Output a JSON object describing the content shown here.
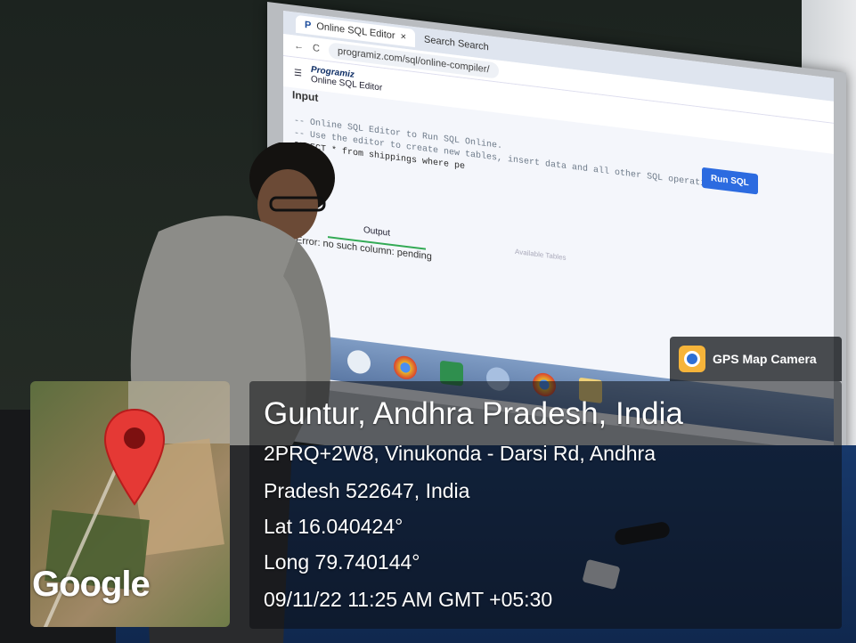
{
  "screen": {
    "tab_title": "Online SQL Editor",
    "tab2_title": "Search Search",
    "url_domain": "programiz.com",
    "url_path": "/sql/online-compiler/",
    "brand_name": "Programiz",
    "brand_sub": "Online SQL Editor",
    "input_label": "Input",
    "code_line1": "-- Online SQL Editor to Run SQL Online.",
    "code_line2": "-- Use the editor to create new tables, insert data and all other SQL operations.",
    "code_line3": "SELECT * from shippings where pe",
    "run_button": "Run SQL",
    "output_tab": "Output",
    "available_tab": "Available Tables",
    "error_text": "Error: no such column: pending"
  },
  "gps": {
    "badge_label": "GPS Map Camera",
    "map_brand": "Google",
    "location_title": "Guntur, Andhra Pradesh, India",
    "address_line1": "2PRQ+2W8, Vinukonda - Darsi Rd, Andhra",
    "address_line2": "Pradesh 522647, India",
    "lat": "Lat 16.040424°",
    "long": "Long 79.740144°",
    "datetime": "09/11/22 11:25 AM GMT +05:30"
  },
  "colors": {
    "pin": "#e53935",
    "run_button": "#2c6be0",
    "table_cloth": "#17386a"
  }
}
